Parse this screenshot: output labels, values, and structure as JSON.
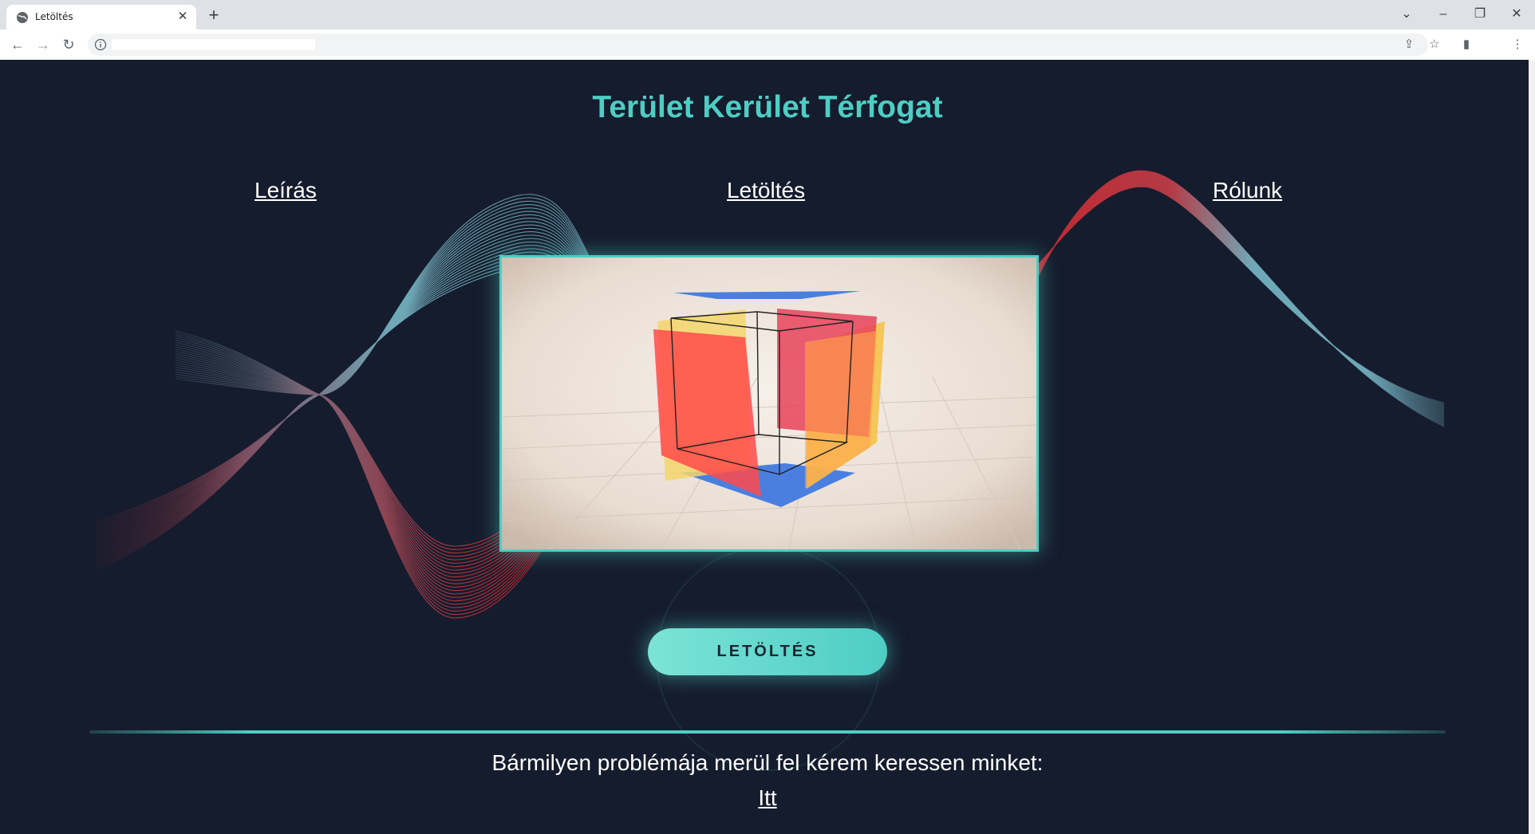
{
  "browser": {
    "tab_title": "Letöltés",
    "tab_close": "✕",
    "new_tab": "+",
    "tab_list": "⌄",
    "minimize": "–",
    "restore": "❐",
    "close": "✕",
    "back": "←",
    "forward": "→",
    "reload": "↻",
    "url": "",
    "share": "⇪",
    "bookmark": "☆",
    "sidepanel": "▮",
    "menu": "⋮"
  },
  "page": {
    "title": "Terület Kerület Térfogat",
    "nav": {
      "leiras": "Leírás",
      "letoltes": "Letöltés",
      "rolunk": "Rólunk"
    },
    "download_button": "LETÖLTÉS",
    "contact_text": "Bármilyen problémája merül fel kérem keressen minket:",
    "contact_link": "Itt"
  },
  "colors": {
    "background": "#151c2d",
    "accent": "#4ecdc4",
    "wave_blue": "#6fa9b8",
    "wave_red": "#c0282f"
  }
}
